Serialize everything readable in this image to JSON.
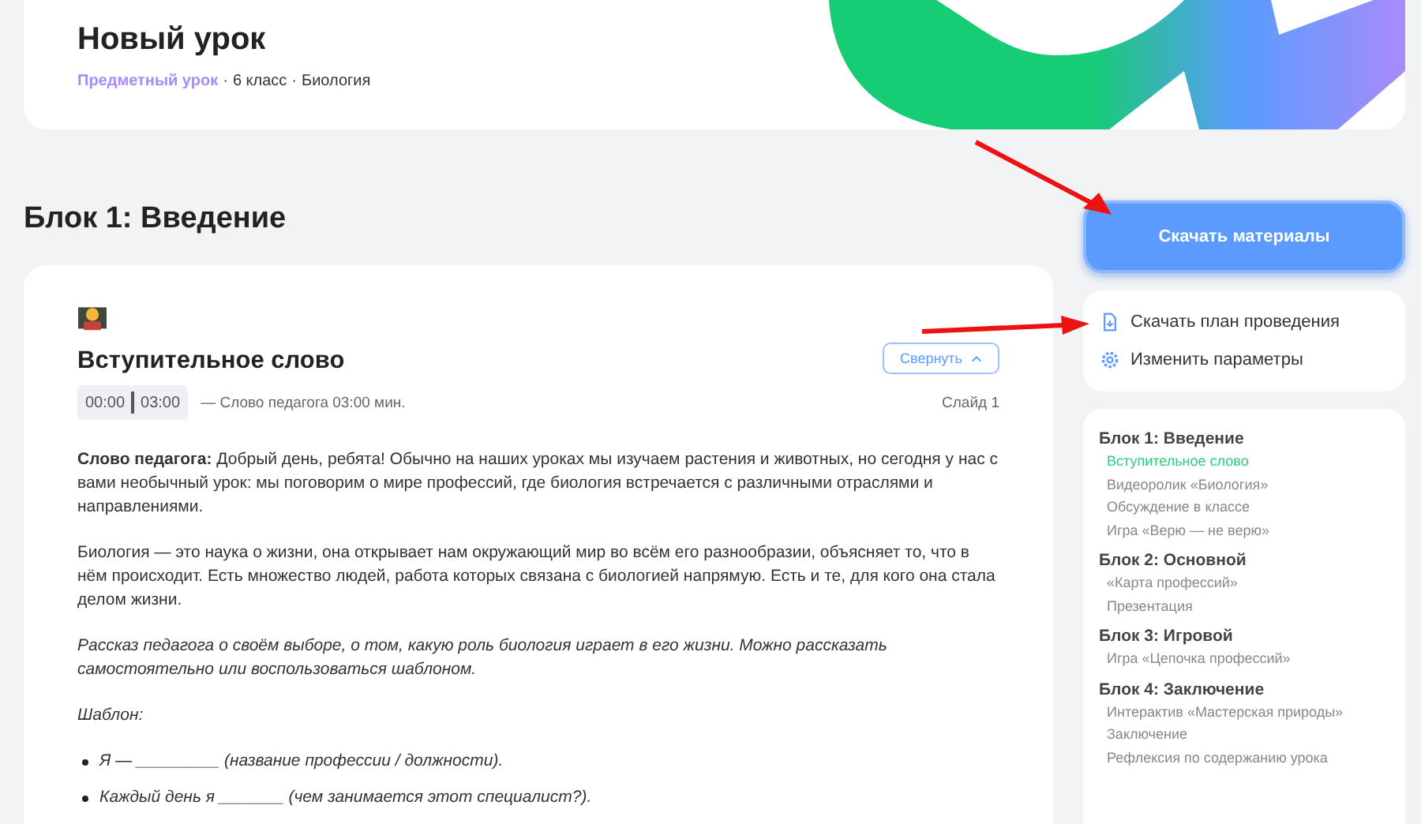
{
  "lesson": {
    "title": "Новый урок",
    "separator": "·",
    "meta": [
      {
        "text": "Предметный урок",
        "kind": "type"
      },
      {
        "text": "6 класс",
        "kind": "plain"
      },
      {
        "text": "Биология",
        "kind": "plain"
      }
    ]
  },
  "block_title": "Блок 1: Введение",
  "step": {
    "title": "Вступительное слово",
    "collapse_button": "Свернуть",
    "time_start": "00:00",
    "time_end": "03:00",
    "time_note": "— Слово педагога 03:00 мин.",
    "slide": "Слайд 1",
    "paragraphs": [
      {
        "kind": "text",
        "text": "**Слово педагога:** Добрый день, ребята! Обычно на наших уроках мы изучаем растения и животных, но сегодня у нас с вами необычный урок: мы поговорим о мире профессий, где биология встречается с различными отраслями и направлениями."
      },
      {
        "kind": "text",
        "text": "Биология — это наука о жизни, она открывает нам окружающий мир во всём его разнообразии, объясняет то, что в нём происходит. Есть множество людей, работа которых связана с биологией напрямую. Есть и те, для кого она стала делом жизни."
      },
      {
        "kind": "note",
        "text": "Рассказ педагога о своём выборе, о том, какую роль биология играет в его жизни. Можно рассказать самостоятельно или воспользоваться шаблоном."
      },
      {
        "kind": "note",
        "text": "Шаблон:"
      },
      {
        "kind": "bullet",
        "text": "Я — _________ (название профессии / должности)."
      },
      {
        "kind": "bullet",
        "text": "Каждый день я _______ (чем занимается этот специалист?)."
      }
    ]
  },
  "download_button": "Скачать материалы",
  "actions": [
    {
      "label": "Скачать план проведения",
      "kind": "download"
    },
    {
      "label": "Изменить параметры",
      "kind": "settings"
    }
  ],
  "outline": [
    {
      "title": "Блок 1: Введение",
      "items": [
        {
          "label": "Вступительное слово",
          "selected": true
        },
        {
          "label": "Видеоролик «Биология»",
          "selected": false
        },
        {
          "label": "Обсуждение в классе",
          "selected": false
        },
        {
          "label": "Игра «Верю — не верю»",
          "selected": false
        }
      ]
    },
    {
      "title": "Блок 2: Основной",
      "items": [
        {
          "label": "«Карта профессий»",
          "selected": false
        },
        {
          "label": "Презентация",
          "selected": false
        }
      ]
    },
    {
      "title": "Блок 3: Игровой",
      "items": [
        {
          "label": "Игра «Цепочка профессий»",
          "selected": false
        }
      ]
    },
    {
      "title": "Блок 4: Заключение",
      "items": [
        {
          "label": "Интерактив «Мастерская природы»",
          "selected": false
        },
        {
          "label": "Заключение",
          "selected": false
        },
        {
          "label": "Рефлексия по содержанию урока",
          "selected": false
        }
      ]
    }
  ]
}
